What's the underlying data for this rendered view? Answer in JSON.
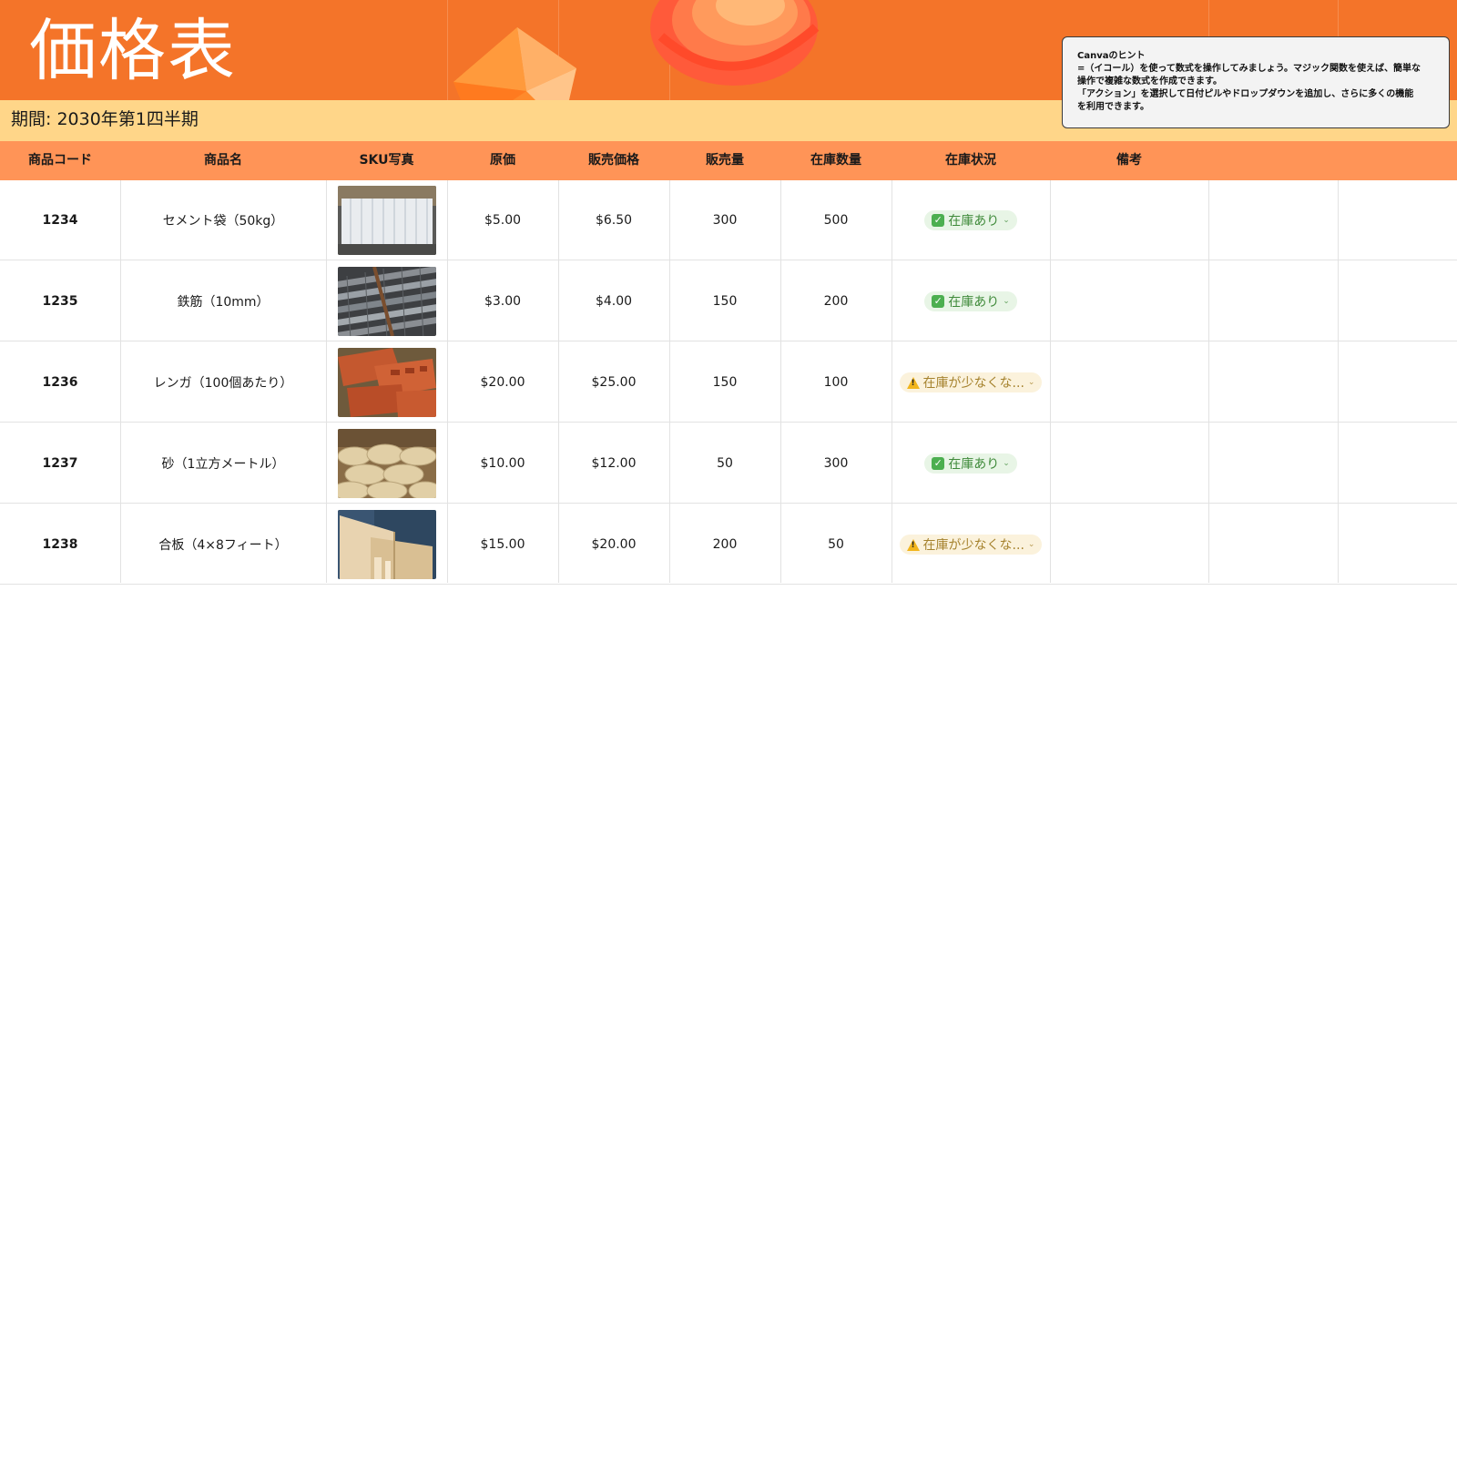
{
  "sheet": {
    "title": "価格表",
    "period": "期間: 2030年第1四半期"
  },
  "hint": {
    "line1": "Canvaのヒント",
    "line2": "=（イコール）を使って数式を操作してみましょう。マジック関数を使えば、簡単な",
    "line3": "操作で複雑な数式を作成できます。",
    "line4": "「アクション」を選択して日付ピルやドロップダウンを追加し、さらに多くの機能",
    "line5": "を利用できます。"
  },
  "columns": [
    "商品コード",
    "商品名",
    "SKU写真",
    "原価",
    "販売価格",
    "販売量",
    "在庫数量",
    "在庫状況",
    "備考"
  ],
  "rows": [
    {
      "code": "1234",
      "name": "セメント袋（50kg）",
      "photo": "cement-bags",
      "cost": "$5.00",
      "price": "$6.50",
      "sold": "300",
      "stock": "500",
      "status": "在庫あり",
      "status_type": "ok"
    },
    {
      "code": "1235",
      "name": "鉄筋（10mm）",
      "photo": "rebar",
      "cost": "$3.00",
      "price": "$4.00",
      "sold": "150",
      "stock": "200",
      "status": "在庫あり",
      "status_type": "ok"
    },
    {
      "code": "1236",
      "name": "レンガ（100個あたり）",
      "photo": "bricks",
      "cost": "$20.00",
      "price": "$25.00",
      "sold": "150",
      "stock": "100",
      "status": "在庫が少なくな...",
      "status_type": "low"
    },
    {
      "code": "1237",
      "name": "砂（1立方メートル）",
      "photo": "sand-bags",
      "cost": "$10.00",
      "price": "$12.00",
      "sold": "50",
      "stock": "300",
      "status": "在庫あり",
      "status_type": "ok"
    },
    {
      "code": "1238",
      "name": "合板（4×8フィート）",
      "photo": "plywood",
      "cost": "$15.00",
      "price": "$20.00",
      "sold": "200",
      "stock": "50",
      "status": "在庫が少なくな...",
      "status_type": "low"
    }
  ],
  "colors": {
    "header_orange": "#f47429",
    "period_yellow": "#ffd689",
    "table_header": "#ff9457",
    "status_ok": "#3f8a3a",
    "status_low": "#a5822d"
  }
}
